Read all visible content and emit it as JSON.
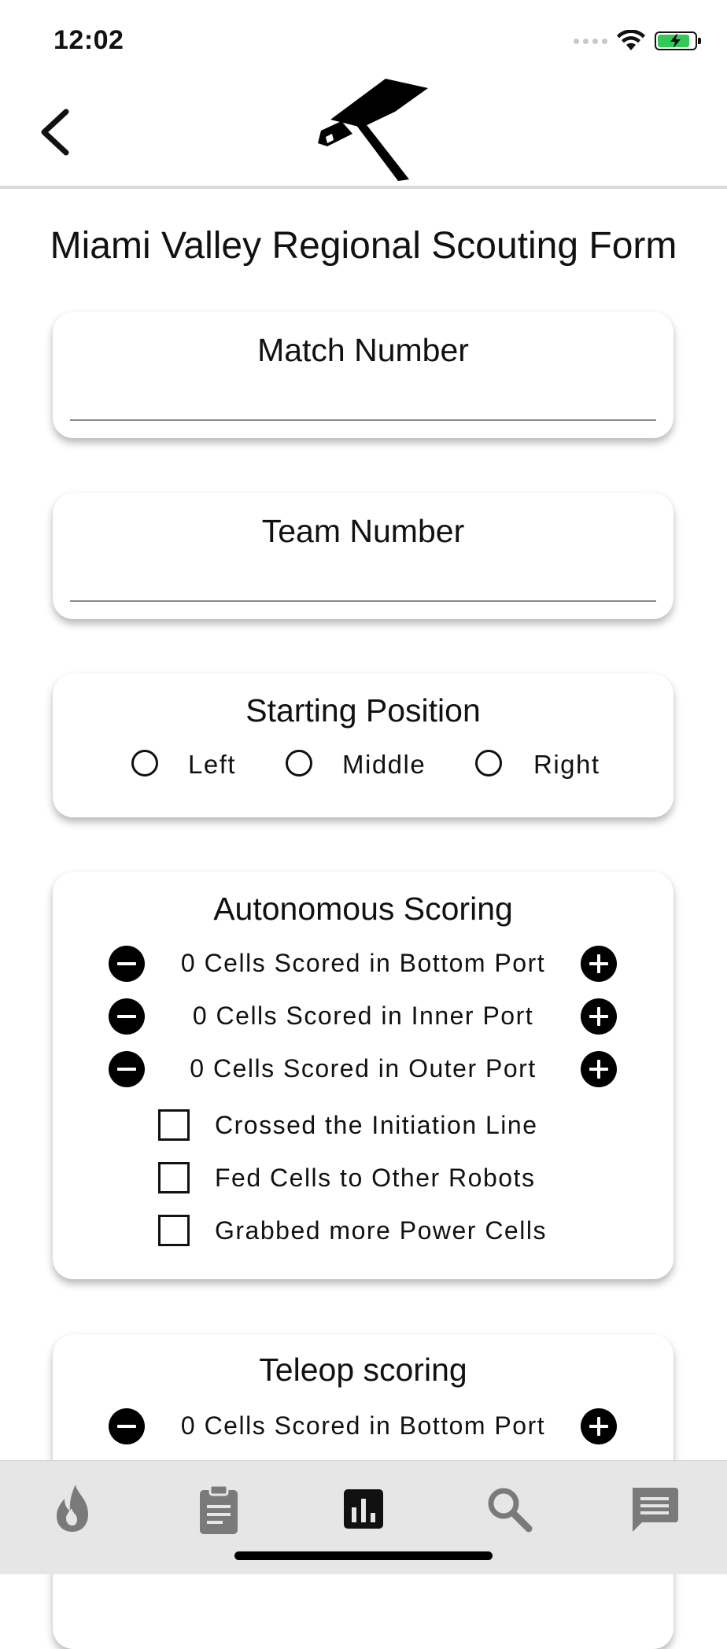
{
  "status_bar": {
    "time": "12:02"
  },
  "form": {
    "title": "Miami Valley Regional Scouting Form",
    "match_number": {
      "label": "Match Number",
      "value": ""
    },
    "team_number": {
      "label": "Team Number",
      "value": ""
    },
    "starting_position": {
      "label": "Starting Position",
      "options": [
        "Left",
        "Middle",
        "Right"
      ],
      "selected": null
    },
    "autonomous": {
      "label": "Autonomous Scoring",
      "counters": [
        "0 Cells Scored in Bottom Port",
        "0 Cells Scored in Inner Port",
        "0 Cells Scored in Outer Port"
      ],
      "checkboxes": [
        "Crossed the Initiation Line",
        "Fed Cells to Other Robots",
        "Grabbed more Power Cells"
      ]
    },
    "teleop": {
      "label": "Teleop scoring",
      "counters": [
        "0 Cells Scored in Bottom Port"
      ]
    }
  },
  "tab_bar": {
    "tabs": [
      "flame-icon",
      "clipboard-icon",
      "bar-chart-icon",
      "search-icon",
      "chat-icon"
    ],
    "active": "bar-chart-icon",
    "colors": {
      "active": "#111111",
      "inactive": "#7a7a7a"
    }
  }
}
